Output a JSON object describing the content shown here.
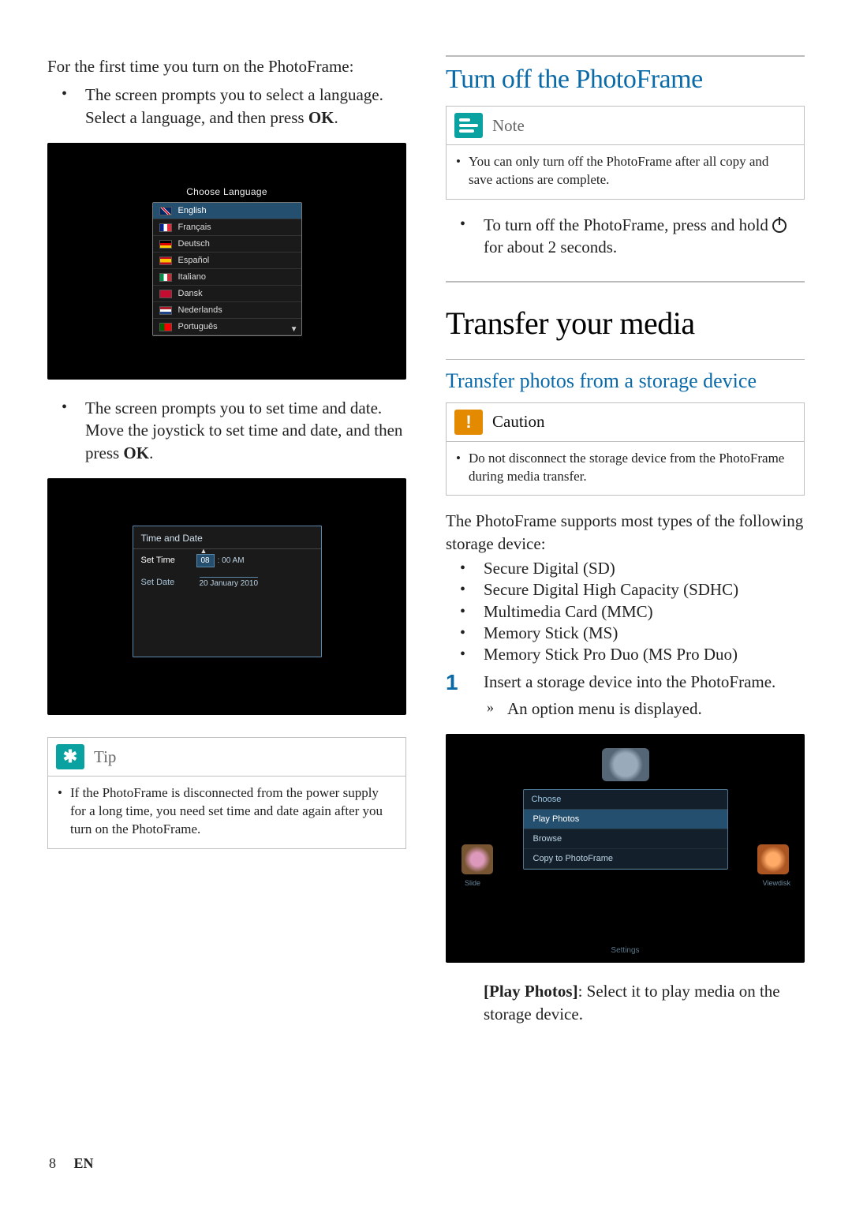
{
  "left": {
    "intro": "For the first time you turn on the PhotoFrame:",
    "bullet1_a": "The screen prompts you to select a language. Select a language, and then press ",
    "bullet1_ok": "OK",
    "bullet1_b": ".",
    "fig1": {
      "title": "Choose Language",
      "items": [
        "English",
        "Français",
        "Deutsch",
        "Español",
        "Italiano",
        "Dansk",
        "Nederlands",
        "Português"
      ]
    },
    "bullet2_a": "The screen prompts you to set time and date. Move the joystick to set time and date, and then press ",
    "bullet2_ok": "OK",
    "bullet2_b": ".",
    "fig2": {
      "panel_title": "Time and Date",
      "row1_label": "Set Time",
      "row1_hour": "08",
      "row1_rest": ": 00  AM",
      "row2_label": "Set Date",
      "row2_value": "20 January 2010"
    },
    "tip": {
      "label": "Tip",
      "text": "If the PhotoFrame is disconnected from the power supply for a long time, you need set time and date again after you turn on the PhotoFrame."
    }
  },
  "right": {
    "h_turnoff": "Turn off the PhotoFrame",
    "note": {
      "label": "Note",
      "text": "You can only turn off the PhotoFrame after all copy and save actions are complete."
    },
    "turnoff_bullet_a": "To turn off the PhotoFrame, press and hold ",
    "turnoff_bullet_b": " for about 2 seconds.",
    "h_transfer": "Transfer your media",
    "h_transfer_sub": "Transfer photos from a storage device",
    "caution": {
      "label": "Caution",
      "text": "Do not disconnect the storage device from the PhotoFrame during media transfer."
    },
    "support_para": "The PhotoFrame supports most types of the following storage device:",
    "devices": [
      "Secure Digital (SD)",
      "Secure Digital High Capacity (SDHC)",
      "Multimedia Card (MMC)",
      "Memory Stick (MS)",
      "Memory Stick Pro Duo (MS Pro Duo)"
    ],
    "step1_num": "1",
    "step1_text": "Insert a storage device into the PhotoFrame.",
    "step1_result": "An option menu is displayed.",
    "fig3": {
      "menu_title": "Choose",
      "items": [
        "Play Photos",
        "Browse",
        "Copy to PhotoFrame"
      ],
      "left_label": "Slide",
      "right_label": "Viewdisk",
      "footer": "Settings"
    },
    "play_photos_label": "[Play Photos]",
    "play_photos_text": ": Select it to play media on the storage device."
  },
  "footer": {
    "page": "8",
    "lang": "EN"
  }
}
